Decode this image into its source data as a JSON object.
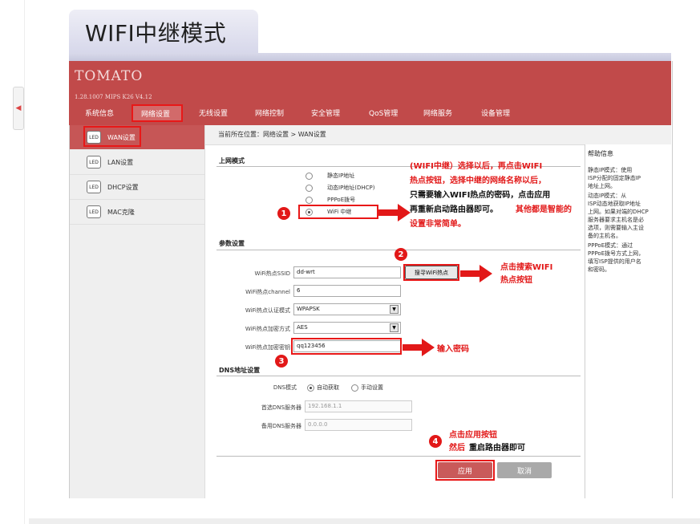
{
  "page_title": "WIFI中继模式",
  "router": {
    "brand": "TOMATO",
    "version": "1.28.1007 MIPS K26 V4.12",
    "nav": [
      "系统信息",
      "网络设置",
      "无线设置",
      "网络控制",
      "安全管理",
      "QoS管理",
      "网络服务",
      "设备管理"
    ],
    "nav_active_index": 1
  },
  "sidebar": {
    "items": [
      {
        "icon_text": "LED",
        "label": "WAN设置",
        "active": true
      },
      {
        "icon_text": "LED",
        "label": "LAN设置"
      },
      {
        "icon_text": "LED",
        "label": "DHCP设置"
      },
      {
        "icon_text": "LED",
        "label": "MAC克隆"
      }
    ]
  },
  "breadcrumb": "当前所在位置：网络设置 > WAN设置",
  "connection": {
    "title": "上网模式",
    "options": [
      "静态IP地址",
      "动态IP地址(DHCP)",
      "PPPoE拨号",
      "WiFi 中继"
    ],
    "selected": "WiFi 中继"
  },
  "params": {
    "title": "参数设置",
    "ssid_label": "WiFi热点SSID",
    "ssid_value": "dd-wrt",
    "scan_button": "搜寻WiFi热点",
    "channel_label": "WiFi热点channel",
    "channel_value": "6",
    "auth_label": "WiFi热点认证模式",
    "auth_value": "WPAPSK",
    "enc_label": "WiFi热点加密方式",
    "enc_value": "AES",
    "key_label": "WiFi热点加密密钥",
    "key_value": "qq123456"
  },
  "dns": {
    "title": "DNS地址设置",
    "mode_label": "DNS模式",
    "auto_label": "自动获取",
    "manual_label": "手动设置",
    "primary_label": "首选DNS服务器",
    "primary_value": "192.168.1.1",
    "secondary_label": "备用DNS服务器",
    "secondary_value": "0.0.0.0"
  },
  "buttons": {
    "apply": "应用",
    "cancel": "取消"
  },
  "help": {
    "title": "帮助信息",
    "lines": [
      "静态IP模式：使用",
      "ISP分配的固定静态IP",
      "地址上网。",
      "动态IP模式：从",
      "ISP动态地获取IP地址",
      "上网。如果对端的DHCP",
      "服务器要求主机名是必",
      "选项，则需要输入主设",
      "备的主机名。",
      "PPPoE模式：通过",
      "PPPoE拨号方式上网，",
      "填写ISP提供的用户名",
      "和密码。"
    ]
  },
  "annotations": {
    "step1_line1": "(WIFI中继）选择以后，再点击WIFI",
    "step1_line2": "热点按钮，选择中继的网络名称以后，",
    "step1_line3": "只需要输入WIFI热点的密码，点击应用",
    "step1_line4a": "再重新启动路由器即可。",
    "step1_line4b": "其他都是智能的",
    "step1_line5": "设置非常简单。",
    "step2_line1": "点击搜索WIFI",
    "step2_line2": "热点按钮",
    "step3": "输入密码",
    "step4_line1": "点击应用按钮",
    "step4_line2a": "然后",
    "step4_line2b": "重启路由器即可",
    "num1": "1",
    "num2": "2",
    "num3": "3",
    "num4": "4"
  },
  "colors": {
    "header": "#c14a4a",
    "accent_red": "#e21818",
    "apply": "#c95a5a",
    "cancel": "#a9a9a9"
  }
}
